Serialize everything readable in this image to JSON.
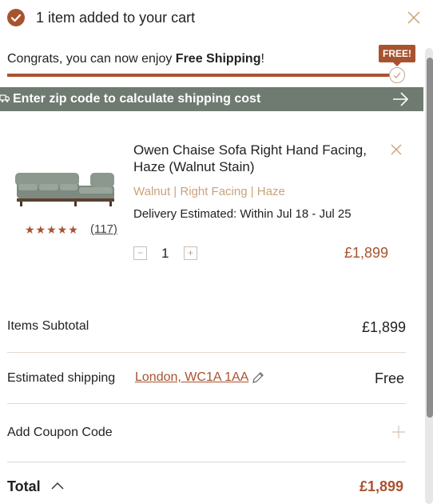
{
  "header": {
    "added_text": "1 item added to your cart",
    "check_icon": "check-circle-icon",
    "close_icon": "close-icon"
  },
  "shipping_progress": {
    "congrats_prefix": "Congrats, you can now enjoy ",
    "congrats_bold": "Free Shipping",
    "congrats_suffix": "!",
    "badge": "FREE!",
    "progress_fraction": 1.0
  },
  "zip_bar": {
    "label": "Enter zip code to calculate shipping cost",
    "icon": "truck-icon",
    "arrow_icon": "arrow-right-icon"
  },
  "product": {
    "name": "Owen Chaise Sofa Right Hand Facing, Haze (Walnut Stain)",
    "variant": "Walnut | Right Facing | Haze",
    "delivery": "Delivery Estimated: Within Jul 18 - Jul 25",
    "rating_stars": "★★★★★",
    "rating": 4.5,
    "review_count": "(117)",
    "quantity": "1",
    "price": "£1,899"
  },
  "summary": {
    "subtotal_label": "Items Subtotal",
    "subtotal_value": "£1,899",
    "shipping_label": "Estimated shipping",
    "shipping_location": "London, WC1A 1AA",
    "shipping_value": "Free",
    "coupon_label": "Add Coupon Code",
    "total_label": "Total",
    "total_value": "£1,899"
  },
  "colors": {
    "accent": "#a8532f",
    "zip_bar_bg": "#6f7a70",
    "variant_text": "#c8a37a"
  }
}
